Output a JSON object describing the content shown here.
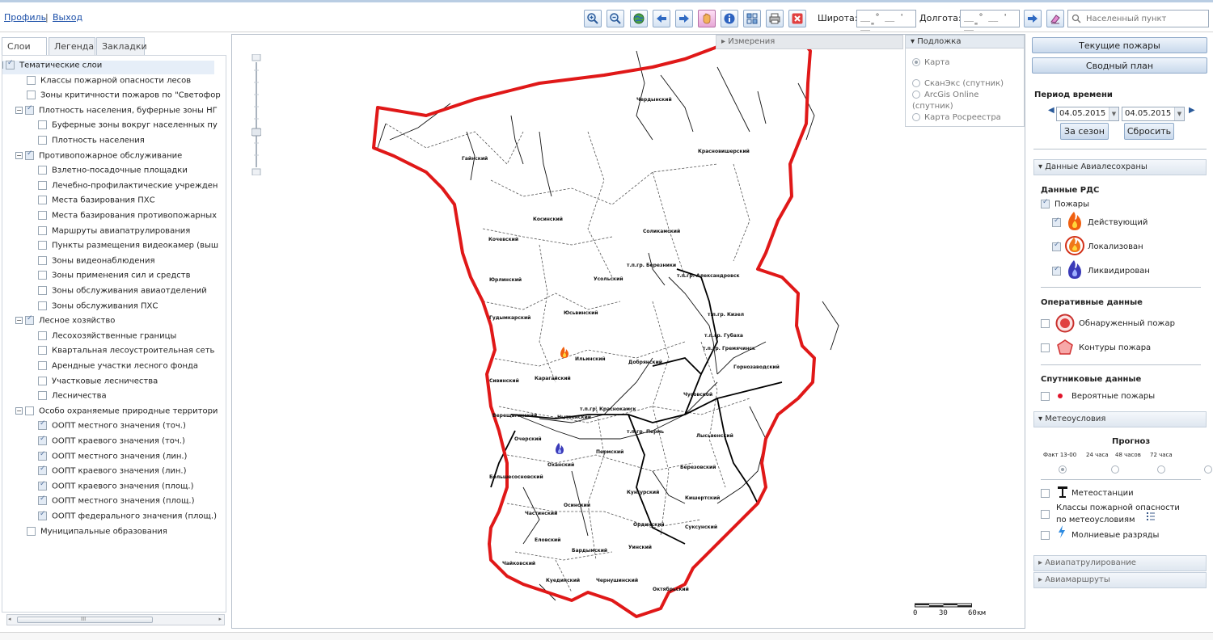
{
  "header": {
    "profile_link": "Профиль",
    "separator": "|",
    "logout_link": "Выход",
    "lat_label": "Широта:",
    "lon_label": "Долгота:",
    "coord_mask": "__ ° __ ' __\"",
    "search_placeholder": "Населенный пункт"
  },
  "toolbar": [
    "zoom-in",
    "zoom-out",
    "globe",
    "arrow-left",
    "arrow-right",
    "pan-hand",
    "info",
    "identify",
    "print",
    "clear"
  ],
  "sidebar": {
    "tabs": [
      "Слои",
      "Легенда",
      "Закладки"
    ],
    "layers": [
      {
        "label": "Тематические слои",
        "level": 0,
        "checked": true,
        "expander": "−"
      },
      {
        "label": "Классы пожарной опасности лесов",
        "level": 1,
        "checked": false
      },
      {
        "label": "Зоны критичности пожаров по \"Светофор",
        "level": 1,
        "checked": false
      },
      {
        "label": "Плотность населения, буферные зоны НГ",
        "level": 1,
        "checked": true,
        "expander": "−"
      },
      {
        "label": "Буферные зоны вокруг населенных пу",
        "level": 2,
        "checked": false
      },
      {
        "label": "Плотность населения",
        "level": 2,
        "checked": false
      },
      {
        "label": "Противопожарное обслуживание",
        "level": 1,
        "checked": true,
        "expander": "−"
      },
      {
        "label": "Взлетно-посадочные площадки",
        "level": 2,
        "checked": false
      },
      {
        "label": "Лечебно-профилактические учрежден",
        "level": 2,
        "checked": false
      },
      {
        "label": "Места базирования ПХС",
        "level": 2,
        "checked": false
      },
      {
        "label": "Места базирования противопожарных",
        "level": 2,
        "checked": false
      },
      {
        "label": "Маршруты авиапатрулирования",
        "level": 2,
        "checked": false
      },
      {
        "label": "Пункты размещения видеокамер (выш",
        "level": 2,
        "checked": false
      },
      {
        "label": "Зоны видеонаблюдения",
        "level": 2,
        "checked": false
      },
      {
        "label": "Зоны применения сил и средств",
        "level": 2,
        "checked": false
      },
      {
        "label": "Зоны обслуживания авиаотделений",
        "level": 2,
        "checked": false
      },
      {
        "label": "Зоны обслуживания ПХС",
        "level": 2,
        "checked": false
      },
      {
        "label": "Лесное хозяйство",
        "level": 1,
        "checked": true,
        "expander": "−"
      },
      {
        "label": "Лесохозяйственные границы",
        "level": 2,
        "checked": false
      },
      {
        "label": "Квартальная лесоустроительная сеть",
        "level": 2,
        "checked": false
      },
      {
        "label": "Арендные участки лесного фонда",
        "level": 2,
        "checked": false
      },
      {
        "label": "Участковые лесничества",
        "level": 2,
        "checked": false
      },
      {
        "label": "Лесничества",
        "level": 2,
        "checked": false
      },
      {
        "label": "Особо охраняемые природные территори",
        "level": 1,
        "checked": false,
        "expander": "−"
      },
      {
        "label": "ООПТ местного значения (точ.)",
        "level": 2,
        "checked": true
      },
      {
        "label": "ООПТ краевого значения (точ.)",
        "level": 2,
        "checked": true
      },
      {
        "label": "ООПТ местного значения (лин.)",
        "level": 2,
        "checked": true
      },
      {
        "label": "ООПТ краевого значения (лин.)",
        "level": 2,
        "checked": true
      },
      {
        "label": "ООПТ краевого значения (площ.)",
        "level": 2,
        "checked": true
      },
      {
        "label": "ООПТ местного значения (площ.)",
        "level": 2,
        "checked": true
      },
      {
        "label": "ООПТ федерального значения (площ.)",
        "level": 2,
        "checked": true
      },
      {
        "label": "Муниципальные образования",
        "level": 1,
        "checked": false
      }
    ],
    "scroll_grip": "III"
  },
  "map": {
    "measure_label": "Измерения",
    "basemap": {
      "title": "Подложка",
      "options": [
        "Карта",
        "СканЭкс (спутник)",
        "ArcGis Online",
        "(спутник)",
        "Карта Росреестра"
      ],
      "selected": "Карта"
    },
    "scale": {
      "labels": [
        "0",
        "30",
        "60км"
      ]
    },
    "places": [
      {
        "name": "Чердынский"
      },
      {
        "name": "Гайнский"
      },
      {
        "name": "Красновишерский"
      },
      {
        "name": "Косинский"
      },
      {
        "name": "Кочевский"
      },
      {
        "name": "Соликамский"
      },
      {
        "name": "т.п.гр. Березники"
      },
      {
        "name": "Усольский"
      },
      {
        "name": "т.п.гр. Александровск"
      },
      {
        "name": "Юрлинский"
      },
      {
        "name": "Гудымкарский"
      },
      {
        "name": "Юсьвинский"
      },
      {
        "name": "т.п.гр. Кизел"
      },
      {
        "name": "т.п.гр. Губаха"
      },
      {
        "name": "т.п.гр. Гремячинск"
      },
      {
        "name": "Ильинский"
      },
      {
        "name": "Добрянский"
      },
      {
        "name": "Горнозаводский"
      },
      {
        "name": "Сивинский"
      },
      {
        "name": "Карагайский"
      },
      {
        "name": "Чусовской"
      },
      {
        "name": "т.п.гр. Краснокамск"
      },
      {
        "name": "Верещагинский"
      },
      {
        "name": "Нытвенский"
      },
      {
        "name": "т.п.гр. Пермь"
      },
      {
        "name": "Лысьвенский"
      },
      {
        "name": "Очерский"
      },
      {
        "name": "Пермский"
      },
      {
        "name": "Оханский"
      },
      {
        "name": "Березовский"
      },
      {
        "name": "Большесосновский"
      },
      {
        "name": "Кунгурский"
      },
      {
        "name": "Осинский"
      },
      {
        "name": "Кишертский"
      },
      {
        "name": "Частинский"
      },
      {
        "name": "Ординский"
      },
      {
        "name": "Суксунский"
      },
      {
        "name": "Еловский"
      },
      {
        "name": "Уинский"
      },
      {
        "name": "Бардымский"
      },
      {
        "name": "Чайковский"
      },
      {
        "name": "Куединский"
      },
      {
        "name": "Чернушинский"
      },
      {
        "name": "Октябрьский"
      }
    ],
    "fire_markers": [
      {
        "status": "active",
        "district": "Ильинский"
      },
      {
        "status": "liquidated",
        "district": "Оханский"
      }
    ],
    "colors": {
      "border": "#e01818",
      "rivers": "#111111",
      "districts": "#444444"
    }
  },
  "right": {
    "current_fires_btn": "Текущие пожары",
    "summary_btn": "Сводный план",
    "period_title": "Период времени",
    "date_from": "04.05.2015",
    "date_to": "04.05.2015",
    "season_btn": "За сезон",
    "reset_btn": "Сбросить",
    "avia_section": "Данные Авиалесохраны",
    "rds_title": "Данные РДС",
    "fires_label": "Пожары",
    "fire_statuses": [
      {
        "label": "Действующий",
        "color": "#f06010"
      },
      {
        "label": "Локализован",
        "color": "#f07818"
      },
      {
        "label": "Ликвидирован",
        "color": "#3a3ab8"
      }
    ],
    "operative_title": "Оперативные данные",
    "detected_fire": "Обнаруженный пожар",
    "fire_contours": "Контуры пожара",
    "satellite_title": "Спутниковые данные",
    "probable_fires": "Вероятные пожары",
    "meteo_section": "Метеоусловия",
    "forecast_title": "Прогноз",
    "forecast_options": [
      "Факт 13-00",
      "24 часа",
      "48 часов",
      "72 часа"
    ],
    "forecast_selected": "Факт 13-00",
    "weather_stations": "Метеостанции",
    "meteo_classes_1": "Классы пожарной опасности",
    "meteo_classes_2": "по метеоусловиям",
    "lightning": "Молниевые разряды",
    "avia_patrol": "Авиапатрулирование",
    "avia_routes": "Авиамаршруты"
  }
}
